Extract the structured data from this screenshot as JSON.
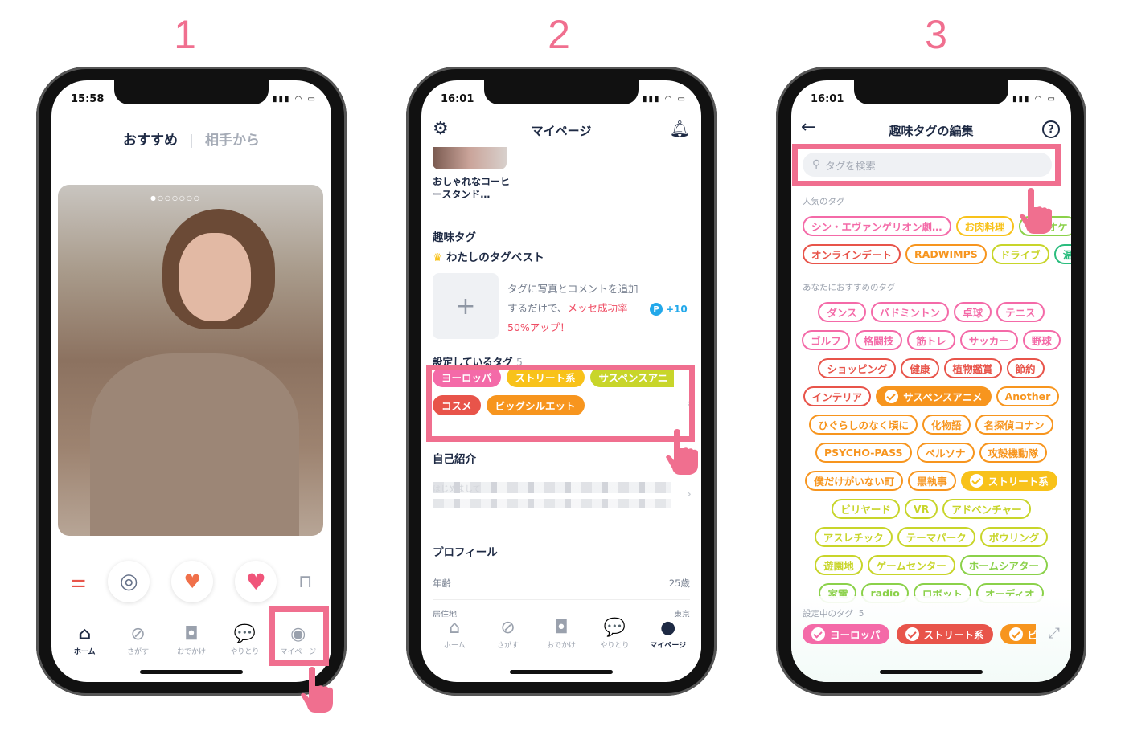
{
  "steps": [
    "1",
    "2",
    "3"
  ],
  "colors": {
    "accent": "#f06f8f",
    "navy": "#1e2a44",
    "pink": "#f46aa8",
    "red": "#e8544a",
    "orange": "#f7951e",
    "yellow": "#f8c21a",
    "lime": "#c8d52a",
    "green": "#8bd14a",
    "teal": "#2bbd7e",
    "point": "#22a8ea"
  },
  "phone1": {
    "time": "15:58",
    "tabs": [
      "おすすめ",
      "相手から"
    ],
    "card_caption": "",
    "actions": [
      {
        "icon": "filter-icon"
      },
      {
        "icon": "swirl-icon"
      },
      {
        "icon": "heart-arrow-icon"
      },
      {
        "icon": "heart-icon"
      },
      {
        "icon": "bag-icon"
      }
    ],
    "nav": [
      {
        "label": "ホーム",
        "icon": "home-icon",
        "active": true
      },
      {
        "label": "さがす",
        "icon": "compass-icon"
      },
      {
        "label": "おでかけ",
        "icon": "door-icon"
      },
      {
        "label": "やりとり",
        "icon": "chat-icon"
      },
      {
        "label": "マイページ",
        "icon": "user-icon"
      }
    ]
  },
  "phone2": {
    "time": "16:01",
    "title": "マイページ",
    "photo_caption": "おしゃれなコーヒースタンド…",
    "hobby_title": "趣味タグ",
    "best_title": "わたしのタグベスト",
    "promo": {
      "text1": "タグに写真とコメントを追加するだけで、",
      "text2": "メッセ成功率50%アップ！",
      "points": "+10",
      "point_badge": "P"
    },
    "set_tags_label": "設定しているタグ",
    "set_tags_count": "5",
    "set_tags": [
      {
        "label": "ヨーロッパ",
        "color": "pink"
      },
      {
        "label": "ストリート系",
        "color": "yellow"
      },
      {
        "label": "サスペンスアニ",
        "color": "lime"
      },
      {
        "label": "コスメ",
        "color": "red"
      },
      {
        "label": "ビッグシルエット",
        "color": "orange"
      }
    ],
    "intro_title": "自己紹介",
    "intro_text": "はじめまして",
    "profile_title": "プロフィール",
    "profile": [
      {
        "label": "年齢",
        "value": "25歳"
      },
      {
        "label": "居住地",
        "value": "東京"
      }
    ],
    "nav": [
      {
        "label": "ホーム",
        "icon": "home-icon"
      },
      {
        "label": "さがす",
        "icon": "compass-icon"
      },
      {
        "label": "おでかけ",
        "icon": "door-icon"
      },
      {
        "label": "やりとり",
        "icon": "chat-icon"
      },
      {
        "label": "マイページ",
        "icon": "user-icon",
        "active": true
      }
    ]
  },
  "phone3": {
    "time": "16:01",
    "title": "趣味タグの編集",
    "search_placeholder": "タグを検索",
    "popular_label": "人気のタグ",
    "popular_rows": [
      [
        {
          "label": "シン・エヴァンゲリオン劇…",
          "color": "pink"
        },
        {
          "label": "お肉料理",
          "color": "yellow"
        },
        {
          "label": "カラオケ",
          "color": "green"
        }
      ],
      [
        {
          "label": "オンラインデート",
          "color": "red"
        },
        {
          "label": "RADWIMPS",
          "color": "orange"
        },
        {
          "label": "ドライブ",
          "color": "lime"
        },
        {
          "label": "温泉",
          "color": "teal"
        }
      ]
    ],
    "recommend_label": "あなたにおすすめのタグ",
    "recommend_rows": [
      [
        {
          "label": "ダンス",
          "color": "pink"
        },
        {
          "label": "バドミントン",
          "color": "pink"
        },
        {
          "label": "卓球",
          "color": "pink"
        },
        {
          "label": "テニス",
          "color": "pink"
        }
      ],
      [
        {
          "label": "ゴルフ",
          "color": "pink"
        },
        {
          "label": "格闘技",
          "color": "pink"
        },
        {
          "label": "筋トレ",
          "color": "pink"
        },
        {
          "label": "サッカー",
          "color": "pink"
        },
        {
          "label": "野球",
          "color": "pink"
        }
      ],
      [
        {
          "label": "ショッピング",
          "color": "red"
        },
        {
          "label": "健康",
          "color": "red"
        },
        {
          "label": "植物鑑賞",
          "color": "red"
        },
        {
          "label": "節約",
          "color": "red"
        }
      ],
      [
        {
          "label": "インテリア",
          "color": "red"
        },
        {
          "label": "サスペンスアニメ",
          "color": "orange",
          "selected": true
        },
        {
          "label": "Another",
          "color": "orange"
        }
      ],
      [
        {
          "label": "ひぐらしのなく頃に",
          "color": "orange"
        },
        {
          "label": "化物語",
          "color": "orange"
        },
        {
          "label": "名探偵コナン",
          "color": "orange"
        }
      ],
      [
        {
          "label": "PSYCHO-PASS",
          "color": "orange"
        },
        {
          "label": "ペルソナ",
          "color": "orange"
        },
        {
          "label": "攻殻機動隊",
          "color": "orange"
        }
      ],
      [
        {
          "label": "僕だけがいない町",
          "color": "orange"
        },
        {
          "label": "黒執事",
          "color": "orange"
        },
        {
          "label": "ストリート系",
          "color": "yellow",
          "selected": true
        }
      ],
      [
        {
          "label": "ビリヤード",
          "color": "lime"
        },
        {
          "label": "VR",
          "color": "lime"
        },
        {
          "label": "アドベンチャー",
          "color": "lime"
        }
      ],
      [
        {
          "label": "アスレチック",
          "color": "lime"
        },
        {
          "label": "テーマパーク",
          "color": "lime"
        },
        {
          "label": "ボウリング",
          "color": "lime"
        }
      ],
      [
        {
          "label": "遊園地",
          "color": "lime"
        },
        {
          "label": "ゲームセンター",
          "color": "lime"
        },
        {
          "label": "ホームシアター",
          "color": "green"
        }
      ],
      [
        {
          "label": "家電",
          "color": "green"
        },
        {
          "label": "radio",
          "color": "green"
        },
        {
          "label": "ロボット",
          "color": "green"
        },
        {
          "label": "オーディオ",
          "color": "green"
        }
      ]
    ],
    "selected_label": "設定中のタグ",
    "selected_count": "5",
    "selected": [
      {
        "label": "ヨーロッパ",
        "color": "pink"
      },
      {
        "label": "ストリート系",
        "color": "red"
      },
      {
        "label": "ビッグシルエット",
        "color": "orange"
      }
    ]
  }
}
